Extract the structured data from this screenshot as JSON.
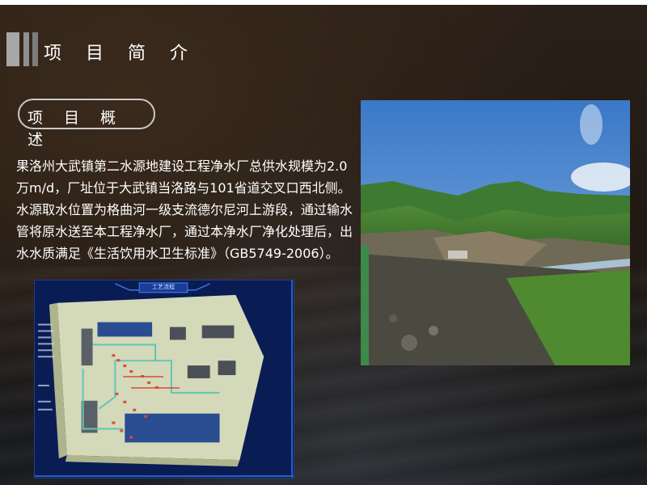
{
  "header": {
    "title": "项目简介"
  },
  "overview": {
    "pill_label": "项目概述"
  },
  "description": "果洛州大武镇第二水源地建设工程净水厂总供水规模为2.0万m/d，厂址位于大武镇当洛路与101省道交叉口西北侧。水源取水位置为格曲河一级支流德尔尼河上游段，通过输水管将原水送至本工程净水厂，通过本净水厂净化处理后，出水水质满足《生活饮用水卫生标准》（GB5749-2006）。",
  "diagram": {
    "title": "工艺流程"
  },
  "colors": {
    "background": "#211913",
    "text": "#ffffff",
    "accent_bar": "#a7a7a7",
    "diagram_bg": "#0b1f5c"
  },
  "icons": {
    "title_marker": "vertical-bars-icon"
  }
}
